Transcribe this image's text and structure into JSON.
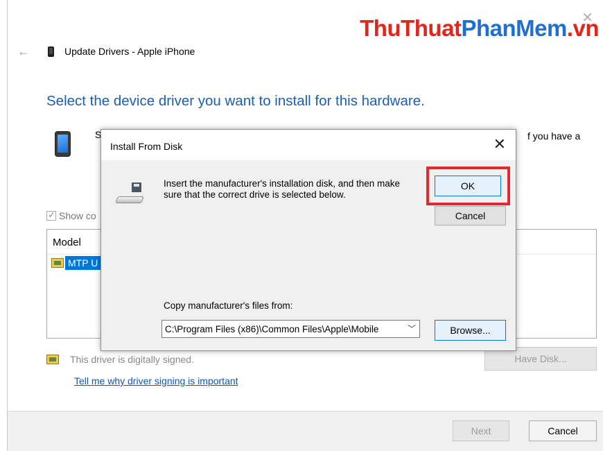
{
  "window": {
    "title": "Update Drivers - Apple iPhone",
    "heading": "Select the device driver you want to install for this hardware.",
    "peek_left_char": "S",
    "peek_right_text": "f you have a",
    "show_compatible_label": "Show co",
    "model_header": "Model",
    "model_item": "MTP U",
    "signed_text": "This driver is digitally signed.",
    "why_link": "Tell me why driver signing is important",
    "have_disk_label": "Have Disk...",
    "next_label": "Next",
    "cancel_label": "Cancel"
  },
  "watermark": {
    "part1": "ThuThuat",
    "part2": "PhanMem",
    "part3": ".vn"
  },
  "dialog": {
    "title": "Install From Disk",
    "message": "Insert the manufacturer's installation disk, and then make sure that the correct drive is selected below.",
    "ok_label": "OK",
    "cancel_label": "Cancel",
    "copy_label": "Copy manufacturer's files from:",
    "path_value": "C:\\Program Files (x86)\\Common Files\\Apple\\Mobile",
    "browse_label": "Browse..."
  },
  "colors": {
    "heading_blue": "#1a5fb4",
    "highlight_red": "#e0282e",
    "selection_blue": "#0078d7"
  }
}
